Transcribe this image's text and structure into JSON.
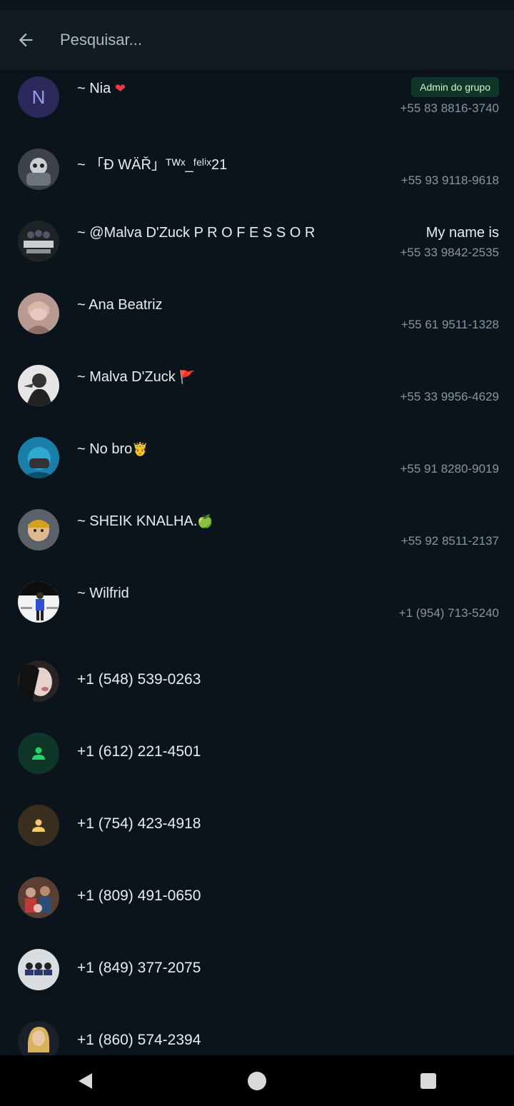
{
  "search": {
    "placeholder": "Pesquisar..."
  },
  "participants": [
    {
      "name": "~ Nia",
      "emoji": "❤",
      "badge": "Admin do grupo",
      "phone": "+55 83 8816-3740"
    },
    {
      "name": "~  「Đ WÄŘ」ᵀᵂˣ_ᶠᵉˡⁱˣ21",
      "phone": "+55 93 9118-9618"
    },
    {
      "name": "~ @Malva D'Zuck     P R O F E S S O R",
      "about": "My name is",
      "phone": "+55 33 9842-2535"
    },
    {
      "name": "~ Ana Beatriz",
      "phone": "+55 61 9511-1328"
    },
    {
      "name": "~ Malva D'Zuck",
      "emoji": "🚩",
      "phone": "+55 33 9956-4629"
    },
    {
      "name": "~ No bro",
      "emoji": "🤴",
      "phone": "+55 91 8280-9019"
    },
    {
      "name": "~ SHEIK KNALHA.",
      "emoji": "🍏",
      "phone": "+55 92 8511-2137"
    },
    {
      "name": "~ Wilfrid",
      "phone": "+1 (954) 713-5240"
    }
  ],
  "unsaved": [
    {
      "number": "+1 (548) 539-0263"
    },
    {
      "number": "+1 (612) 221-4501"
    },
    {
      "number": "+1 (754) 423-4918"
    },
    {
      "number": "+1 (809) 491-0650"
    },
    {
      "number": "+1 (849) 377-2075"
    },
    {
      "number": "+1 (860) 574-2394"
    }
  ],
  "avatar_letter": "N",
  "colors": {
    "background": "#0b141a",
    "header": "#111b21",
    "badge_bg": "#103529",
    "badge_text": "#d1f4cc",
    "secondary_text": "#8696a0"
  },
  "icons": {
    "back": "arrow-left-icon",
    "nav_back": "triangle-back-icon",
    "nav_home": "circle-home-icon",
    "nav_recents": "square-recents-icon"
  }
}
